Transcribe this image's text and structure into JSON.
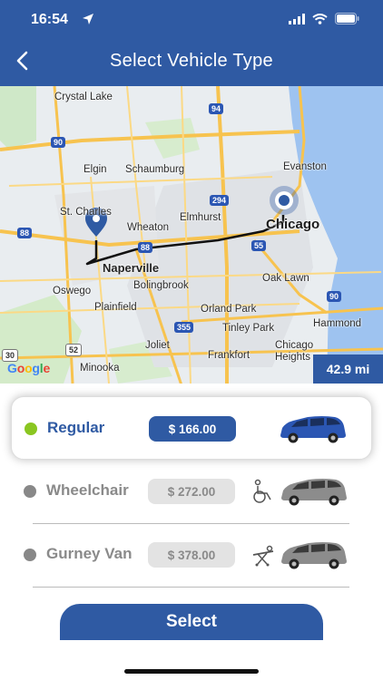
{
  "status_bar": {
    "time": "16:54"
  },
  "header": {
    "title": "Select Vehicle Type"
  },
  "map": {
    "labels": {
      "crystal_lake": "Crystal Lake",
      "elgin": "Elgin",
      "schaumburg": "Schaumburg",
      "evanston": "Evanston",
      "st_charles": "St. Charles",
      "wheaton": "Wheaton",
      "elmhurst": "Elmhurst",
      "chicago": "Chicago",
      "naperville": "Naperville",
      "bolingbrook": "Bolingbrook",
      "oak_lawn": "Oak Lawn",
      "oswego": "Oswego",
      "plainfield": "Plainfield",
      "orland_park": "Orland Park",
      "hammond": "Hammond",
      "tinley_park": "Tinley Park",
      "joliet": "Joliet",
      "frankfort": "Frankfort",
      "chicago_heights": "Chicago Heights",
      "minooka": "Minooka"
    },
    "shields": {
      "s94": "94",
      "s90a": "90",
      "s294": "294",
      "s88a": "88",
      "s88b": "88",
      "s55": "55",
      "s355": "355",
      "s90b": "90",
      "s52": "52",
      "s80": "80",
      "s30": "30"
    },
    "attribution": "Google",
    "distance": "42.9 mi"
  },
  "options": [
    {
      "label": "Regular",
      "price": "$ 166.00",
      "selected": true
    },
    {
      "label": "Wheelchair",
      "price": "$ 272.00",
      "selected": false
    },
    {
      "label": "Gurney Van",
      "price": "$ 378.00",
      "selected": false
    }
  ],
  "colors": {
    "primary": "#2f5aa3",
    "selected_dot": "#8ac621",
    "car_selected": "#2b56b3",
    "car_inactive": "#8c8c8c"
  },
  "icons": [
    "location-arrow-icon",
    "signal-icon",
    "wifi-icon",
    "battery-icon",
    "back-chevron-icon",
    "map-pin-icon",
    "wheelchair-icon",
    "gurney-icon",
    "minivan-icon"
  ],
  "actions": {
    "select_label": "Select"
  }
}
